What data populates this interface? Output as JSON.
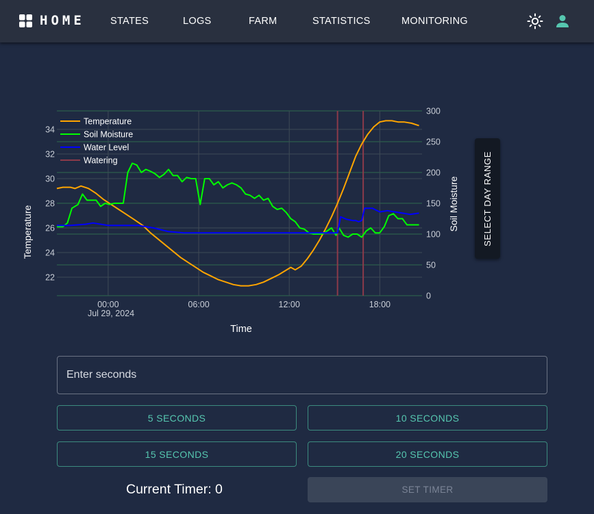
{
  "header": {
    "brand": "HOME",
    "nav": [
      "STATES",
      "LOGS",
      "FARM",
      "STATISTICS",
      "MONITORING"
    ]
  },
  "colors": {
    "background": "#1f2a42",
    "navbar": "#29303f",
    "accent": "#56c7b0",
    "temperature": "#ffa500",
    "soil_moisture": "#00ff00",
    "water_level": "#0000ff",
    "watering": "#8b3a4a"
  },
  "chart_data": {
    "type": "line",
    "xlabel": "Time",
    "ylabel": "Temperature",
    "y2label": "Soil Moisture",
    "x_ticks": [
      "00:00",
      "06:00",
      "12:00",
      "18:00"
    ],
    "x_tick_hours": [
      0,
      6,
      12,
      18
    ],
    "x_date_label": "Jul 29, 2024",
    "xlim_hours": [
      -3.4,
      20.8
    ],
    "ylim": [
      20.5,
      35.5
    ],
    "y_ticks": [
      22,
      24,
      26,
      28,
      30,
      32,
      34
    ],
    "y2lim": [
      0,
      300
    ],
    "y2_ticks": [
      0,
      50,
      100,
      150,
      200,
      250,
      300
    ],
    "legend_position": "top-left",
    "series": [
      {
        "name": "Temperature",
        "axis": "y",
        "color": "#ffa500",
        "x": [
          -3.4,
          -3,
          -2.5,
          -2.2,
          -1.8,
          -1.3,
          -0.8,
          -0.3,
          0.2,
          0.7,
          1.2,
          1.7,
          2.3,
          2.8,
          3.3,
          3.8,
          4.3,
          4.8,
          5.3,
          5.8,
          6.3,
          6.8,
          7.3,
          7.8,
          8.3,
          8.8,
          9.3,
          9.8,
          10.3,
          10.8,
          11.3,
          11.7,
          12.1,
          12.4,
          12.8,
          13.2,
          13.6,
          14,
          14.4,
          14.8,
          15.2,
          15.6,
          16,
          16.4,
          16.8,
          17.2,
          17.6,
          18,
          18.4,
          18.8,
          19.2,
          19.6,
          20.1,
          20.6
        ],
        "values": [
          29.2,
          29.3,
          29.3,
          29.2,
          29.4,
          29.2,
          28.8,
          28.3,
          27.9,
          27.5,
          27.1,
          26.7,
          26.2,
          25.6,
          25.1,
          24.6,
          24.1,
          23.6,
          23.2,
          22.8,
          22.4,
          22.1,
          21.8,
          21.6,
          21.4,
          21.3,
          21.3,
          21.4,
          21.6,
          21.9,
          22.2,
          22.5,
          22.8,
          22.6,
          22.9,
          23.5,
          24.2,
          25,
          25.9,
          26.9,
          28,
          29.2,
          30.5,
          31.8,
          32.8,
          33.6,
          34.2,
          34.6,
          34.7,
          34.7,
          34.6,
          34.6,
          34.5,
          34.3
        ]
      },
      {
        "name": "Soil Moisture",
        "axis": "y2",
        "color": "#00ff00",
        "x": [
          -3.4,
          -3,
          -2.7,
          -2.4,
          -2,
          -1.7,
          -1.4,
          -1.1,
          -0.8,
          -0.5,
          -0.2,
          0.1,
          0.4,
          0.7,
          1,
          1.3,
          1.6,
          1.9,
          2.2,
          2.5,
          2.8,
          3.1,
          3.4,
          3.7,
          4,
          4.3,
          4.6,
          4.9,
          5.2,
          5.5,
          5.8,
          6.1,
          6.4,
          6.7,
          7,
          7.3,
          7.6,
          7.9,
          8.2,
          8.5,
          8.8,
          9.1,
          9.4,
          9.7,
          10,
          10.3,
          10.6,
          10.9,
          11.2,
          11.5,
          11.8,
          12.1,
          12.4,
          12.7,
          13,
          13.3,
          13.6,
          13.9,
          14.2,
          14.5,
          14.8,
          15.1,
          15.3,
          15.6,
          15.9,
          16.2,
          16.5,
          16.8,
          17.1,
          17.4,
          17.7,
          18,
          18.3,
          18.6,
          18.9,
          19.2,
          19.5,
          19.8,
          20.1,
          20.4,
          20.6
        ],
        "values": [
          112,
          112,
          118,
          142,
          148,
          165,
          155,
          155,
          155,
          145,
          150,
          148,
          150,
          150,
          150,
          200,
          215,
          212,
          200,
          205,
          202,
          198,
          192,
          197,
          205,
          195,
          195,
          185,
          192,
          190,
          190,
          148,
          190,
          190,
          180,
          185,
          175,
          180,
          183,
          180,
          175,
          165,
          163,
          158,
          163,
          155,
          158,
          145,
          140,
          142,
          135,
          125,
          120,
          110,
          108,
          102,
          100,
          100,
          100,
          105,
          110,
          98,
          110,
          98,
          95,
          100,
          100,
          95,
          105,
          110,
          102,
          102,
          112,
          130,
          133,
          125,
          125,
          115,
          115,
          115,
          115
        ]
      },
      {
        "name": "Water Level",
        "axis": "y",
        "color": "#0000ff",
        "x": [
          -3.4,
          -2.5,
          -1.5,
          -1,
          0,
          1,
          2,
          3,
          4,
          5,
          6,
          7,
          8,
          9,
          10,
          11,
          12,
          13,
          14,
          15.2,
          15.4,
          15.8,
          16.2,
          16.4,
          16.6,
          16.8,
          17,
          17.5,
          18,
          18.5,
          19,
          19.5,
          20,
          20.6
        ],
        "values": [
          26.2,
          26.2,
          26.3,
          26.4,
          26.2,
          26.2,
          26.2,
          26,
          25.7,
          25.6,
          25.6,
          25.6,
          25.6,
          25.6,
          25.6,
          25.6,
          25.6,
          25.6,
          25.6,
          25.6,
          26.9,
          26.7,
          26.6,
          26.6,
          26.5,
          26.6,
          27.6,
          27.6,
          27.3,
          27.4,
          27.3,
          27.2,
          27.1,
          27.2
        ]
      },
      {
        "name": "Watering",
        "axis": "y",
        "color": "#8b3a4a",
        "events_hours": [
          15.2,
          16.9
        ]
      }
    ]
  },
  "day_range_button": "SELECT DAY RANGE",
  "timer_input": {
    "placeholder": "Enter seconds",
    "value": ""
  },
  "second_buttons": [
    "5 SECONDS",
    "10 SECONDS",
    "15 SECONDS",
    "20 SECONDS"
  ],
  "current_timer_label": "Current Timer: 0",
  "set_timer_button": "SET TIMER"
}
